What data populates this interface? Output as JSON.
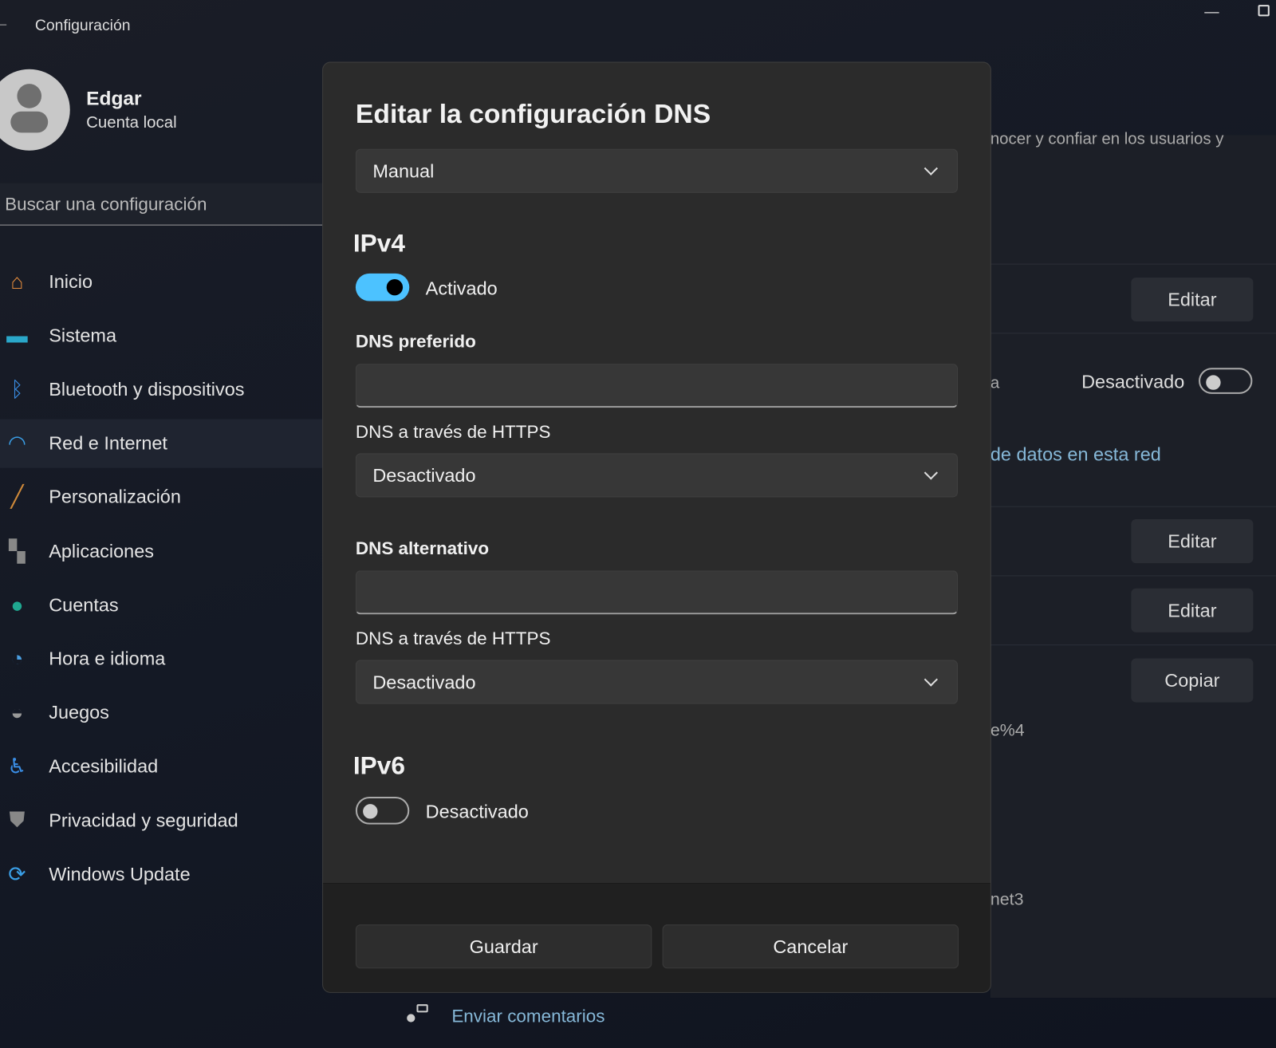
{
  "window": {
    "title": "Configuración",
    "minimize_icon": "minimize-icon",
    "maximize_icon": "maximize-icon"
  },
  "user": {
    "name": "Edgar",
    "account": "Cuenta local"
  },
  "search": {
    "placeholder": "Buscar una configuración"
  },
  "sidebar": {
    "items": [
      {
        "label": "Inicio",
        "icon": "home-icon"
      },
      {
        "label": "Sistema",
        "icon": "monitor-icon"
      },
      {
        "label": "Bluetooth y dispositivos",
        "icon": "bluetooth-icon"
      },
      {
        "label": "Red e Internet",
        "icon": "wifi-icon",
        "selected": true
      },
      {
        "label": "Personalización",
        "icon": "brush-icon"
      },
      {
        "label": "Aplicaciones",
        "icon": "apps-icon"
      },
      {
        "label": "Cuentas",
        "icon": "person-icon"
      },
      {
        "label": "Hora e idioma",
        "icon": "clock-globe-icon"
      },
      {
        "label": "Juegos",
        "icon": "gamepad-icon"
      },
      {
        "label": "Accesibilidad",
        "icon": "accessibility-icon"
      },
      {
        "label": "Privacidad y seguridad",
        "icon": "shield-icon"
      },
      {
        "label": "Windows Update",
        "icon": "update-icon"
      }
    ]
  },
  "background": {
    "text1": "nocer y confiar en los usuarios y",
    "edit1": "Editar",
    "text2": "a",
    "toggle_label": "Desactivado",
    "link": "de datos en esta red",
    "edit2": "Editar",
    "edit3": "Editar",
    "copy": "Copiar",
    "text3": "e%4",
    "text4": "net3"
  },
  "dialog": {
    "title": "Editar la configuración DNS",
    "mode": "Manual",
    "ipv4": {
      "heading": "IPv4",
      "toggle_on": true,
      "toggle_label": "Activado",
      "preferred_label": "DNS preferido",
      "preferred_value": "",
      "https1_label": "DNS a través de HTTPS",
      "https1_value": "Desactivado",
      "alternate_label": "DNS alternativo",
      "alternate_value": "",
      "https2_label": "DNS a través de HTTPS",
      "https2_value": "Desactivado"
    },
    "ipv6": {
      "heading": "IPv6",
      "toggle_on": false,
      "toggle_label": "Desactivado"
    },
    "save": "Guardar",
    "cancel": "Cancelar"
  },
  "feedback": "Enviar comentarios",
  "colors": {
    "accent": "#4cc2ff",
    "link": "#86b8d8"
  }
}
